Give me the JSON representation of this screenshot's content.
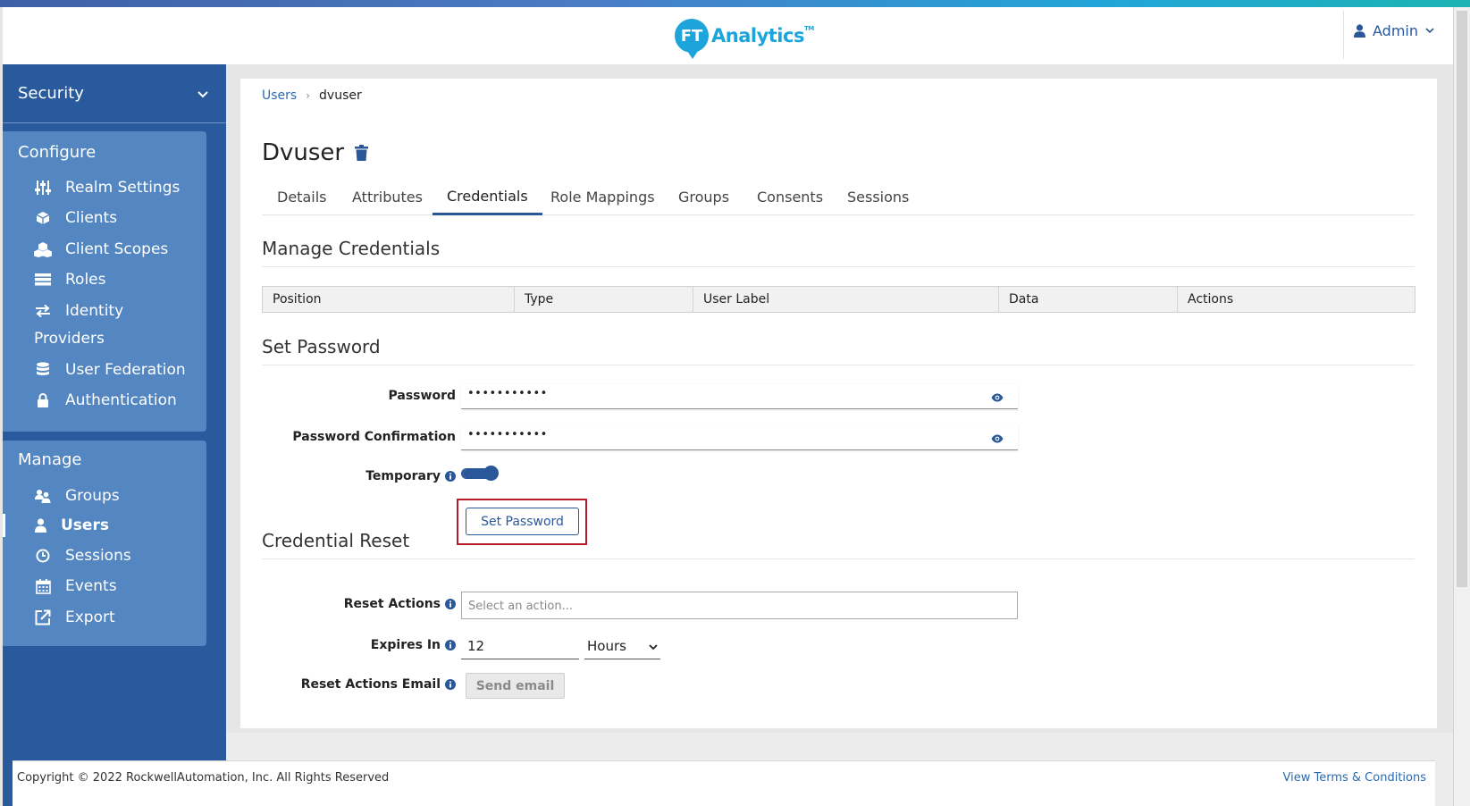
{
  "header": {
    "logo_mark": "FT",
    "logo_text": "Analytics",
    "logo_tm": "TM",
    "user_name": "Admin"
  },
  "sidebar": {
    "realm": "Security",
    "configure_title": "Configure",
    "configure_items": [
      {
        "label": "Realm Settings",
        "icon": "sliders-icon"
      },
      {
        "label": "Clients",
        "icon": "cube-icon"
      },
      {
        "label": "Client Scopes",
        "icon": "cubes-icon"
      },
      {
        "label": "Roles",
        "icon": "list-icon"
      },
      {
        "label": "Identity",
        "icon": "exchange-icon"
      },
      {
        "label": "Providers"
      },
      {
        "label": "User Federation",
        "icon": "database-icon"
      },
      {
        "label": "Authentication",
        "icon": "lock-icon"
      }
    ],
    "manage_title": "Manage",
    "manage_items": [
      {
        "label": "Groups",
        "icon": "users-icon"
      },
      {
        "label": "Users",
        "icon": "user-icon",
        "active": true
      },
      {
        "label": "Sessions",
        "icon": "clock-icon"
      },
      {
        "label": "Events",
        "icon": "calendar-icon"
      },
      {
        "label": "Export",
        "icon": "export-icon"
      }
    ]
  },
  "breadcrumb": {
    "parent": "Users",
    "separator": "›",
    "current": "dvuser"
  },
  "page": {
    "title": "Dvuser"
  },
  "tabs": [
    {
      "label": "Details"
    },
    {
      "label": "Attributes"
    },
    {
      "label": "Credentials",
      "active": true
    },
    {
      "label": "Role Mappings"
    },
    {
      "label": "Groups"
    },
    {
      "label": "Consents"
    },
    {
      "label": "Sessions"
    }
  ],
  "manage_credentials": {
    "title": "Manage Credentials",
    "columns": [
      "Position",
      "Type",
      "User Label",
      "Data",
      "Actions"
    ]
  },
  "set_password": {
    "title": "Set Password",
    "password_label": "Password",
    "password_value": "•••••••••••",
    "confirm_label": "Password Confirmation",
    "confirm_value": "•••••••••••",
    "temporary_label": "Temporary",
    "temporary_on": true,
    "button_label": "Set Password"
  },
  "credential_reset": {
    "title": "Credential Reset",
    "reset_actions_label": "Reset Actions",
    "reset_actions_placeholder": "Select an action...",
    "expires_label": "Expires In",
    "expires_value": "12",
    "expires_unit": "Hours",
    "email_label": "Reset Actions Email",
    "email_button": "Send email"
  },
  "footer": {
    "copyright": "Copyright © 2022 RockwellAutomation, Inc. All Rights Reserved",
    "terms_link": "View Terms & Conditions"
  },
  "colors": {
    "sidebar_bg": "#2a5a9e",
    "sidebar_panel": "#5486c1",
    "accent": "#2a579a",
    "brand": "#1da4da",
    "highlight_box": "#b41e2c"
  }
}
